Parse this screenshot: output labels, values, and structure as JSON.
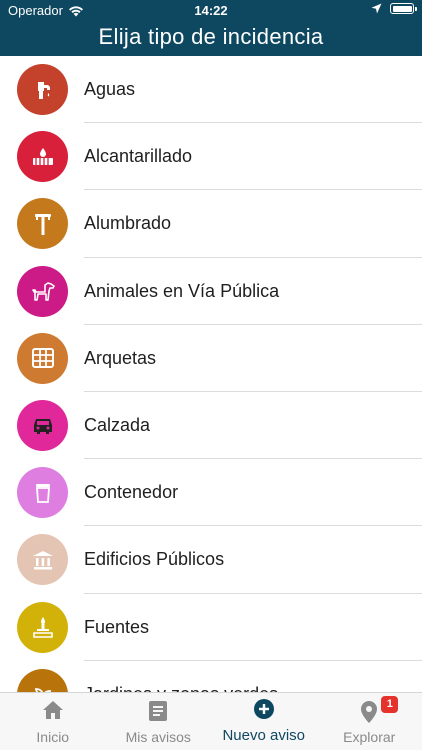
{
  "status": {
    "carrier": "Operador",
    "time": "14:22"
  },
  "header": {
    "title": "Elija tipo de incidencia"
  },
  "categories": [
    {
      "label": "Aguas",
      "color": "#c4422b",
      "icon": "water-tap-icon"
    },
    {
      "label": "Alcantarillado",
      "color": "#d9203a",
      "icon": "sewer-icon"
    },
    {
      "label": "Alumbrado",
      "color": "#c47a1c",
      "icon": "streetlight-icon"
    },
    {
      "label": "Animales en Vía Pública",
      "color": "#cc1a86",
      "icon": "dog-icon"
    },
    {
      "label": "Arquetas",
      "color": "#cf7a31",
      "icon": "grate-icon"
    },
    {
      "label": "Calzada",
      "color": "#e0289a",
      "icon": "car-icon"
    },
    {
      "label": "Contenedor",
      "color": "#de7ee0",
      "icon": "trash-bin-icon"
    },
    {
      "label": "Edificios Públicos",
      "color": "#e4c4b2",
      "icon": "building-icon"
    },
    {
      "label": "Fuentes",
      "color": "#d2b208",
      "icon": "fountain-icon"
    },
    {
      "label": "Jardines y zonas verdes",
      "color": "#b8740a",
      "icon": "plant-icon"
    }
  ],
  "tabs": [
    {
      "label": "Inicio",
      "icon": "home-icon",
      "active": false
    },
    {
      "label": "Mis avisos",
      "icon": "document-icon",
      "active": false
    },
    {
      "label": "Nuevo aviso",
      "icon": "plus-circle-icon",
      "active": true
    },
    {
      "label": "Explorar",
      "icon": "location-pin-icon",
      "active": false,
      "badge": "1"
    }
  ]
}
